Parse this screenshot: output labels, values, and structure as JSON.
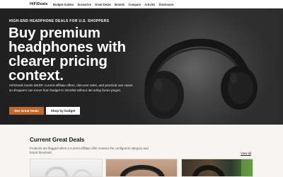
{
  "header": {
    "logo": "HiFiDeals",
    "nav": [
      "Budget Guides",
      "Scenarios",
      "Great Deals",
      "Brands",
      "Compare",
      "Articles",
      "Disclosure"
    ]
  },
  "hero": {
    "eyebrow": "HIGH-END HEADPHONE DEALS FOR U.S. SHOPPERS",
    "title": "Buy premium headphones with clearer pricing context.",
    "description": "HiFiDeals tracks MSRP, current affiliate offers, discount rates, and practical use cases so shoppers can move from budget to shortlist without decoding forum jargon.",
    "primary_button": "See Great Deals",
    "secondary_button": "Shop by budget"
  },
  "deals": {
    "title": "Current Great Deals",
    "description": "Products are flagged when a current affiliate offer crosses the configured category and brand threshold.",
    "view_all": "View all"
  },
  "colors": {
    "accent": "#c26a2e",
    "hero_dark": "#2e2e2e",
    "page_bg": "#f6f5f2"
  },
  "icons": [
    "headphones-photo",
    "deal-card-image"
  ]
}
